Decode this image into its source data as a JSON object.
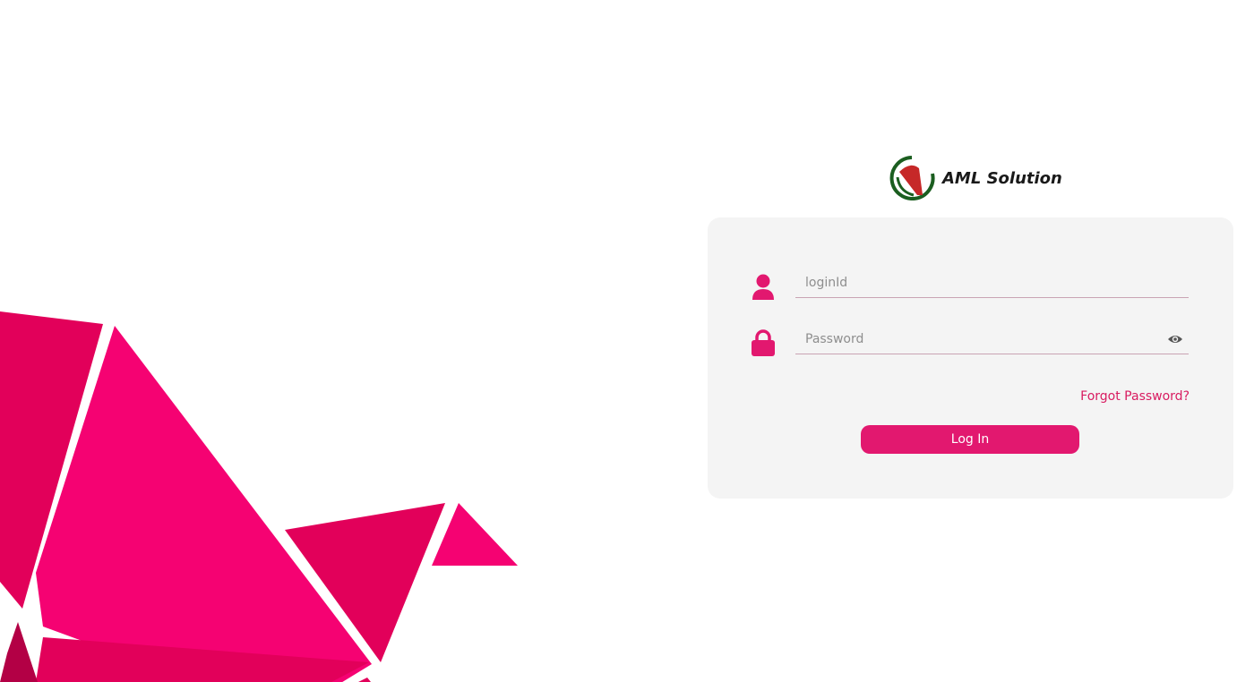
{
  "brand": {
    "name": "AML Solution"
  },
  "login_form": {
    "login_id": {
      "value": "",
      "placeholder": "loginId"
    },
    "password": {
      "value": "",
      "placeholder": "Password"
    },
    "forgot_password_label": "Forgot Password?",
    "submit_label": "Log In"
  },
  "icons": [
    "user-icon",
    "lock-icon",
    "eye-icon"
  ],
  "colors": {
    "accent": "#e2186f",
    "link": "#d81b60",
    "card_background": "#f4f4f4",
    "bird_primary": "#f50272",
    "bird_dark": "#e2005a",
    "bird_darker": "#b30045",
    "logo_green": "#1b5e20",
    "logo_red": "#c62828"
  }
}
